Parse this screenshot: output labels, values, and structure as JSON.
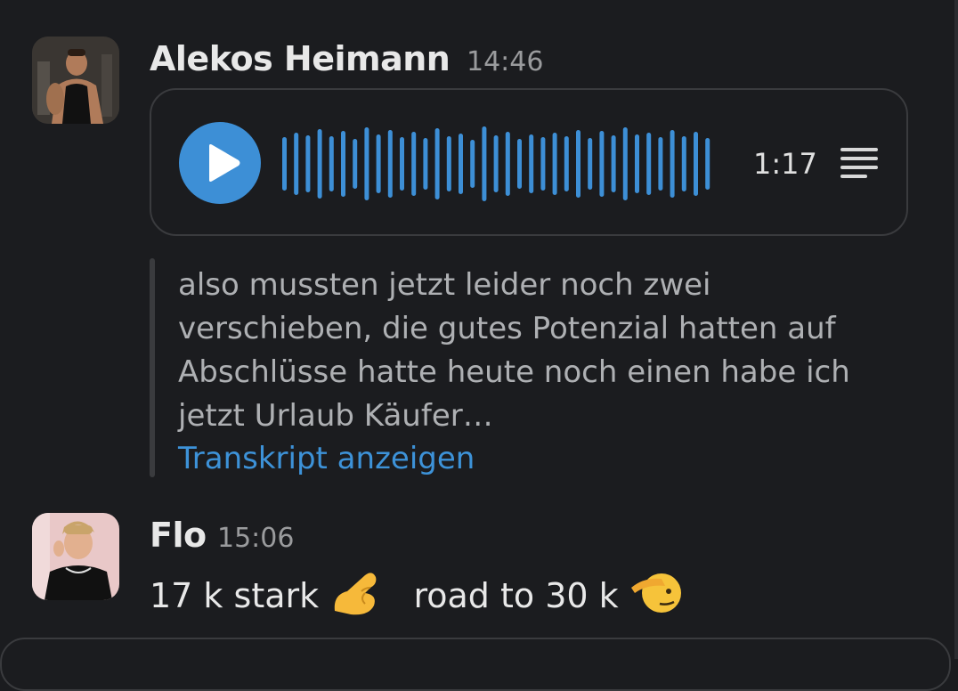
{
  "colors": {
    "background": "#1b1c1f",
    "accent": "#3d8fd6",
    "link": "#3d92d8",
    "text": "#e8e8e8",
    "muted": "#9a9b9d"
  },
  "messages": [
    {
      "author": "Alekos Heimann",
      "time": "14:46",
      "avatar_icon": "user-avatar-photo",
      "audio": {
        "duration": "1:17",
        "play_icon": "play-icon",
        "transcript_icon": "transcript-lines-icon"
      },
      "transcript": "also mussten jetzt leider noch zwei verschieben, die gutes Potenzial hatten auf Abschlüsse hatte heute noch einen habe ich jetzt Urlaub Käufer…",
      "transcript_link": "Transkript anzeigen"
    },
    {
      "author": "Flo",
      "time": "15:06",
      "avatar_icon": "user-avatar-photo",
      "text_part1": "17 k stark",
      "emoji1": "pinching-hand-emoji",
      "text_part2": "road to 30 k",
      "emoji2": "saluting-face-emoji"
    }
  ]
}
